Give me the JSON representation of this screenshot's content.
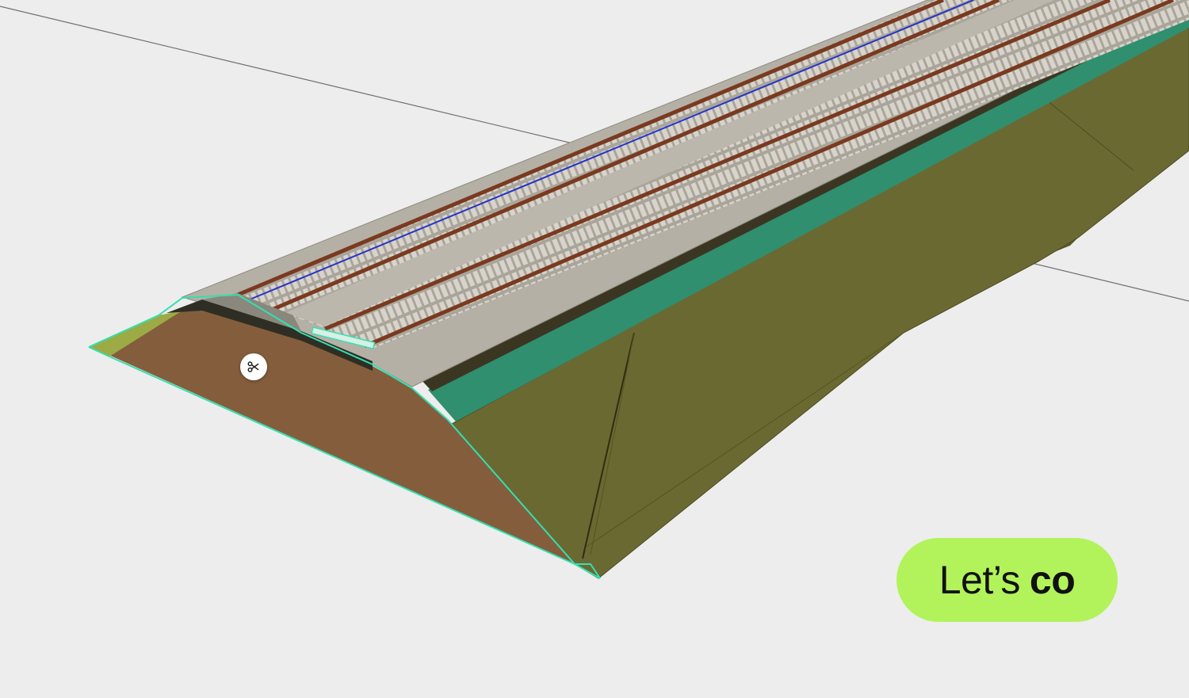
{
  "scene": {
    "description_icon": "section-cut-icon",
    "colors": {
      "background": "#ededed",
      "ground_side": "#6e6c34",
      "soil_section": "#845e3c",
      "ballast": "#b7b2a8",
      "sleeper": "#d6d2ca",
      "rail": "#7a3a20",
      "selection_outline": "#33e0b0",
      "alignment_line": "#2533c8"
    }
  },
  "cta": {
    "text_regular": "Let’s",
    "text_bold": "co",
    "color": "#b2f35c"
  }
}
